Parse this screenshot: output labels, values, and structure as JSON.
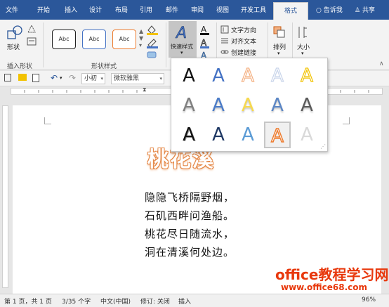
{
  "tabs": [
    "文件",
    "开始",
    "插入",
    "设计",
    "布局",
    "引用",
    "邮件",
    "审阅",
    "视图",
    "开发工具",
    "格式"
  ],
  "active_tab": "格式",
  "tell_me": "告诉我",
  "share": "共享",
  "ribbon": {
    "shape_label": "形状",
    "insert_shapes_group": "插入形状",
    "shape_styles": [
      "Abc",
      "Abc",
      "Abc"
    ],
    "shape_styles_group": "形状样式",
    "quick_styles": "快速样式",
    "text_direction": "文字方向",
    "align_text": "对齐文本",
    "create_link": "创建链接",
    "arrange": "排列",
    "size": "大小"
  },
  "toolbar": {
    "font_size": "小初",
    "font_name": "微软雅黑"
  },
  "quick_styles_gallery": {
    "rows": [
      [
        "A",
        "A",
        "A",
        "A",
        "A"
      ],
      [
        "A",
        "A",
        "A",
        "A",
        "A"
      ],
      [
        "A",
        "A",
        "A",
        "A",
        "A"
      ]
    ],
    "colors": [
      [
        "#111111",
        "#4472c4",
        "#f4b183",
        "#c9d5ea",
        "#f2c200"
      ],
      [
        "#7f7f7f",
        "#4a7bc8",
        "#f7d94c",
        "#5b86c5",
        "#595959"
      ],
      [
        "#111111",
        "#1f3864",
        "#5b9bd5",
        "#ed7d31",
        "#d9d9d9"
      ]
    ],
    "selected": [
      2,
      3
    ]
  },
  "document": {
    "title": "桃花溪",
    "lines": [
      "隐隐飞桥隔野烟，",
      "石矶西畔问渔船。",
      "桃花尽日随流水，",
      "洞在清溪何处边。"
    ]
  },
  "status": {
    "page": "第 1 页，共 1 页",
    "words": "3/35 个字",
    "language": "中文(中国)",
    "track": "修订: 关闭",
    "mode": "插入",
    "zoom": "96%"
  },
  "watermark": {
    "line1": "office教程学习网",
    "line2": "www.office68.com"
  },
  "colors": {
    "ribbon_blue": "#2b579a",
    "title_orange": "#e58a4a",
    "watermark_red": "#e8380c"
  }
}
